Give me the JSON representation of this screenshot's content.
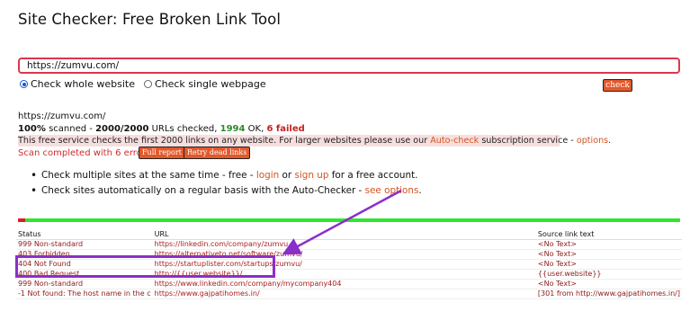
{
  "page": {
    "title": "Site Checker: Free Broken Link Tool"
  },
  "form": {
    "url_value": "https://zumvu.com/",
    "options": [
      {
        "label": "Check whole website",
        "selected": true
      },
      {
        "label": "Check single webpage",
        "selected": false
      }
    ],
    "check_label": "check"
  },
  "results": {
    "site": "https://zumvu.com/",
    "scanned_pct": "100%",
    "scanned_word": "scanned -",
    "urls_count": "2000/2000",
    "urls_checked": "URLs checked,",
    "ok_count": "1994",
    "ok_word": "OK,",
    "failed": "6 failed",
    "notice_text": "This free service checks the first 2000 links on any website. For larger websites please use our",
    "notice_link_autocheck": "Auto-check",
    "notice_mid": "subscription service -",
    "notice_link_options": "options",
    "notice_end": ".",
    "scan_done": "Scan completed with 6 errors.",
    "full_report_label": "Full report",
    "retry_label": "Retry dead links"
  },
  "bullets": {
    "b1_pre": "Check multiple sites at the same time - free -",
    "b1_login": "login",
    "b1_or": "or",
    "b1_signup": "sign up",
    "b1_post": "for a free account.",
    "b2_pre": "Check sites automatically on a regular basis with the Auto-Checker -",
    "b2_link": "see options",
    "b2_post": "."
  },
  "progress": {
    "fraction_failed": 0.003,
    "fail_color": "#d81e1e",
    "ok_color": "#2ee62e"
  },
  "table": {
    "headers": [
      "Status",
      "URL",
      "Source link text"
    ],
    "rows": [
      [
        "999 Non-standard",
        "https://linkedin.com/company/zumvu",
        "<No Text>"
      ],
      [
        "403 Forbidden",
        "https://alternativeto.net/software/zumvu/",
        "<No Text>"
      ],
      [
        "404 Not Found",
        "https://startuplister.com/startups/zumvu/",
        "<No Text>"
      ],
      [
        "400 Bad Request",
        "http://{{user.website}}/",
        "{{user.website}}"
      ],
      [
        "999 Non-standard",
        "https://www.linkedin.com/company/mycompany404",
        "<No Text>"
      ],
      [
        "-1 Not found: The host name in the c",
        "https://www.gajpatihomes.in/",
        "[301 from http://www.gajpatihomes.in/]"
      ]
    ]
  },
  "colors": {
    "accent_button": "#e2592c",
    "annotation_purple": "#8a2fc9",
    "input_border": "#d9384c"
  }
}
